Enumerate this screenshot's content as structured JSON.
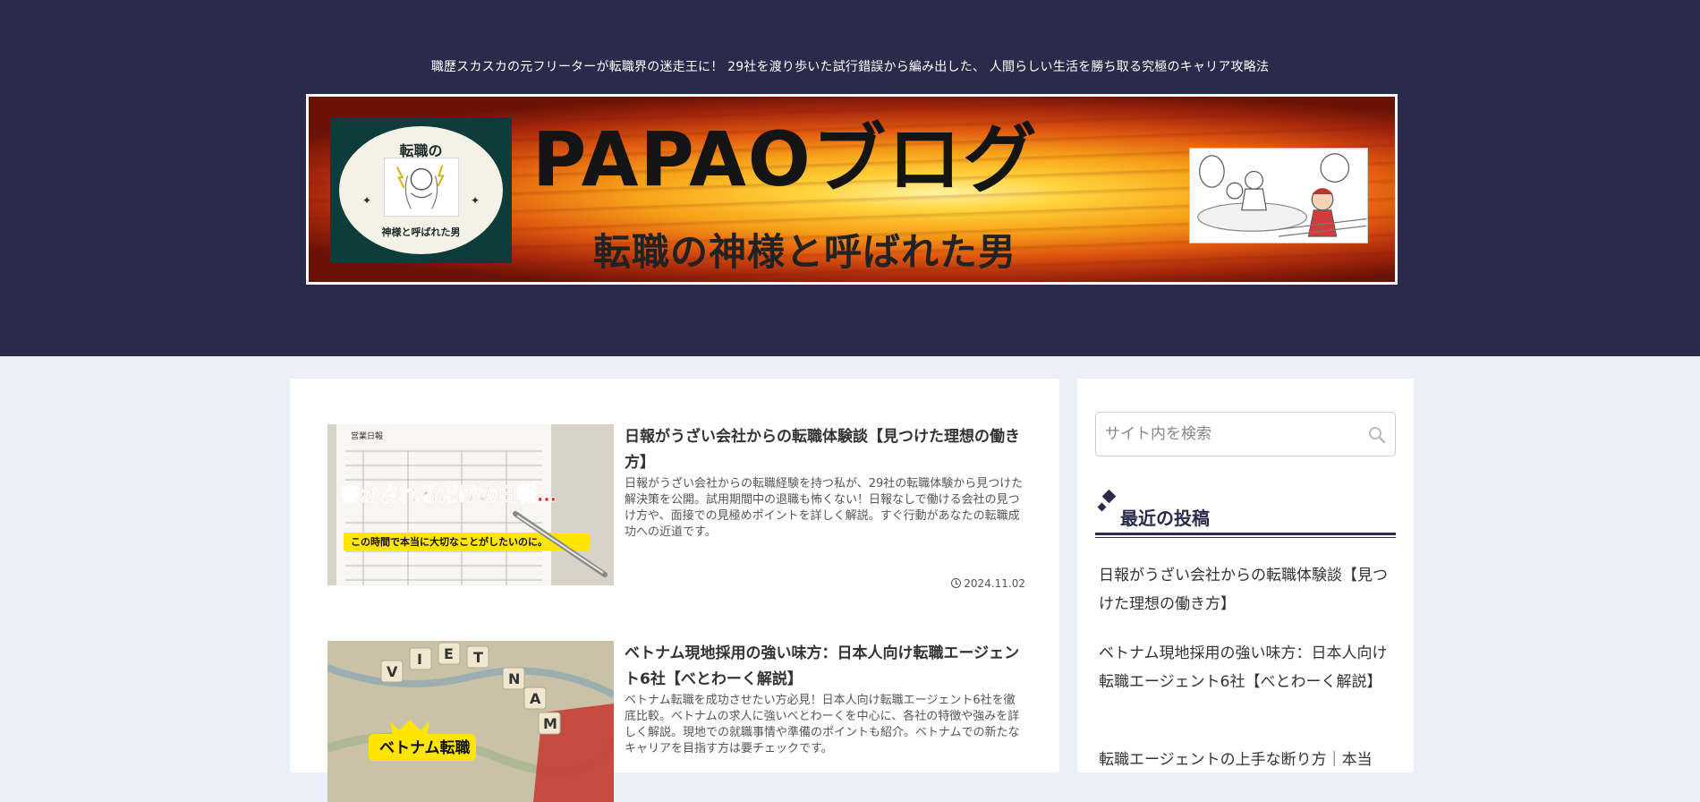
{
  "header": {
    "tagline": "職歴スカスカの元フリーターが転職界の迷走王に！ 29社を渡り歩いた試行錯誤から編み出した、 人間らしい生活を勝ち取る究極のキャリア攻略法"
  },
  "banner": {
    "title": "PAPAOブログ",
    "subtitle": "転職の神様と呼ばれた男",
    "logo_top": "転職の",
    "logo_bottom": "神様と呼ばれた男",
    "colors": {
      "background": "#2a2b4b",
      "accent": "#f7a21a"
    }
  },
  "posts": [
    {
      "title": "日報がうざい会社からの転職体験談【見つけた理想の働き方】",
      "excerpt": "日報がうざい会社からの転職経験を持つ私が、29社の転職体験から見つけた解決策を公開。試用期間中の退職も怖くない！日報なしで働ける会社の見つけ方や、面接での見極めポイントを詳しく解説。すぐ行動があなたの転職成功への近道です。",
      "date": "2024.11.02",
      "thumb_caption": "書かされるだけの日報…",
      "thumb_subcaption": "この時間で本当に大切なことがしたいのに。",
      "thumb_doc_title": "営業日報"
    },
    {
      "title": "ベトナム現地採用の強い味方：日本人向け転職エージェント6社【べとわーく解説】",
      "excerpt": "ベトナム転職を成功させたい方必見！日本人向け転職エージェント6社を徹底比較。ベトナムの求人に強いべとわーくを中心に、各社の特徴や強みを詳しく解説。現地での就職事情や準備のポイントも紹介。ベトナムでの新たなキャリアを目指す方は要チェックです。",
      "thumb_caption": "ベトナム転職"
    }
  ],
  "sidebar": {
    "search_placeholder": "サイト内を検索",
    "recent_title": "最近の投稿",
    "recent_posts": [
      "日報がうざい会社からの転職体験談【見つけた理想の働き方】",
      "ベトナム現地採用の強い味方：日本人向け転職エージェント6社【べとわーく解説】",
      "転職エージェントの上手な断り方｜本当"
    ]
  }
}
